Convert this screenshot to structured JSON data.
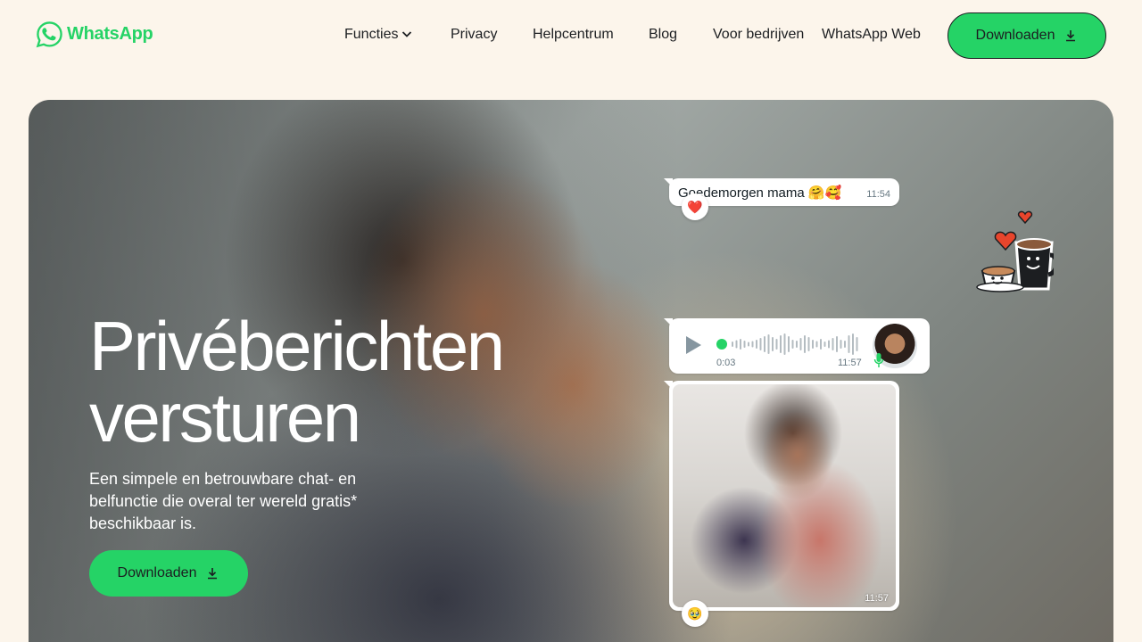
{
  "brand": {
    "name": "WhatsApp",
    "color": "#25d366",
    "icon": "whatsapp-logo-icon"
  },
  "nav": {
    "items": [
      {
        "label": "Functies",
        "has_dropdown": true,
        "icon": "chevron-down-icon"
      },
      {
        "label": "Privacy"
      },
      {
        "label": "Helpcentrum"
      },
      {
        "label": "Blog"
      },
      {
        "label": "Voor bedrijven"
      },
      {
        "label": "WhatsApp Web"
      }
    ],
    "download_label": "Downloaden",
    "download_icon": "download-icon"
  },
  "hero": {
    "title_line1": "Privéberichten",
    "title_line2": "versturen",
    "subtitle": "Een simpele en betrouwbare chat- en belfunctie die overal ter wereld gratis* beschikbaar is.",
    "download_label": "Downloaden"
  },
  "chat": {
    "message1": {
      "text": "Goedemorgen mama 🤗🥰",
      "time": "11:54",
      "reaction": "❤️"
    },
    "voice": {
      "duration": "0:03",
      "time": "11:57",
      "icon": "play-icon"
    },
    "photo": {
      "time": "11:57",
      "reaction": "🥹"
    }
  },
  "colors": {
    "background": "#fcf5eb",
    "accent": "#25d366",
    "text": "#1c1e21"
  }
}
